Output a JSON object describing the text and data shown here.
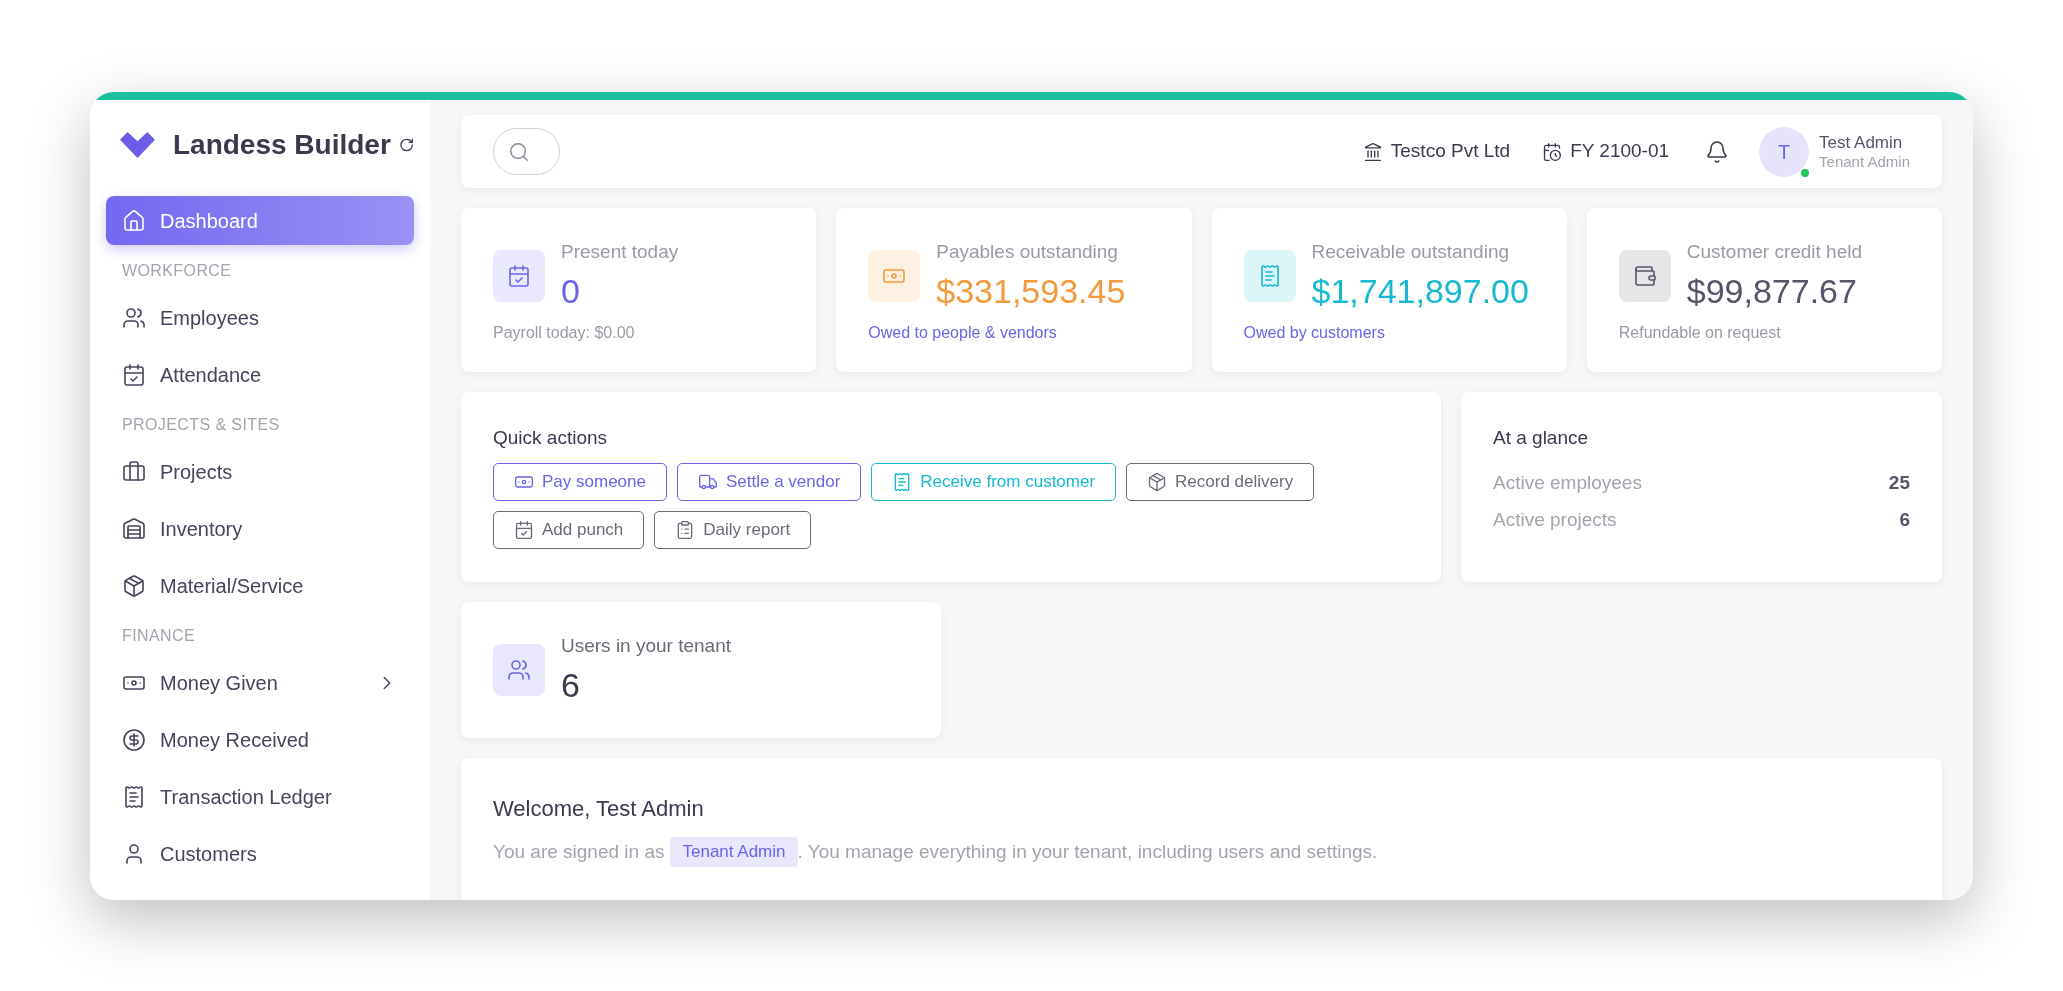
{
  "brand": {
    "name": "Landess Builder"
  },
  "sidebar": {
    "sections": [
      {
        "items": [
          {
            "label": "Dashboard",
            "selected": true,
            "expandable": false
          }
        ]
      },
      {
        "title": "WORKFORCE",
        "items": [
          {
            "label": "Employees",
            "selected": false,
            "expandable": false
          },
          {
            "label": "Attendance",
            "selected": false,
            "expandable": false
          }
        ]
      },
      {
        "title": "PROJECTS & SITES",
        "items": [
          {
            "label": "Projects",
            "selected": false,
            "expandable": false
          },
          {
            "label": "Inventory",
            "selected": false,
            "expandable": false
          },
          {
            "label": "Material/Service",
            "selected": false,
            "expandable": false
          }
        ]
      },
      {
        "title": "FINANCE",
        "items": [
          {
            "label": "Money Given",
            "selected": false,
            "expandable": true
          },
          {
            "label": "Money Received",
            "selected": false,
            "expandable": false
          },
          {
            "label": "Transaction Ledger",
            "selected": false,
            "expandable": false
          },
          {
            "label": "Customers",
            "selected": false,
            "expandable": false
          }
        ]
      }
    ]
  },
  "header": {
    "company": "Testco Pvt Ltd",
    "fiscal_year": "FY 2100-01",
    "user": {
      "initial": "T",
      "name": "Test Admin",
      "role": "Tenant Admin",
      "online": true
    }
  },
  "stats": [
    {
      "label": "Present today",
      "value": "0",
      "note": "Payroll today: $0.00",
      "color": "#6c63e8",
      "note_link": false
    },
    {
      "label": "Payables outstanding",
      "value": "$331,593.45",
      "note": "Owed to people & vendors",
      "color": "#f59a3c",
      "note_link": true
    },
    {
      "label": "Receivable outstanding",
      "value": "$1,741,897.00",
      "note": "Owed by customers",
      "color": "#16b9cf",
      "note_link": true
    },
    {
      "label": "Customer credit held",
      "value": "$99,877.67",
      "note": "Refundable on request",
      "color": "#55556a",
      "note_link": false
    }
  ],
  "quick_actions": {
    "title": "Quick actions",
    "buttons": [
      {
        "label": "Pay someone",
        "color": "#6c63e8"
      },
      {
        "label": "Settle a vendor",
        "color": "#6c63e8"
      },
      {
        "label": "Receive from customer",
        "color": "#16b9cf"
      },
      {
        "label": "Record delivery",
        "color": "#6b6b78"
      },
      {
        "label": "Add punch",
        "color": "#6b6b78"
      },
      {
        "label": "Daily report",
        "color": "#6b6b78"
      }
    ]
  },
  "at_a_glance": {
    "title": "At a glance",
    "rows": [
      {
        "label": "Active employees",
        "value": "25"
      },
      {
        "label": "Active projects",
        "value": "6"
      }
    ]
  },
  "users_card": {
    "label": "Users in your tenant",
    "value": "6"
  },
  "welcome": {
    "title": "Welcome, Test Admin",
    "before": "You are signed in as",
    "badge": "Tenant Admin",
    "after": ". You manage everything in your tenant, including users and settings."
  }
}
